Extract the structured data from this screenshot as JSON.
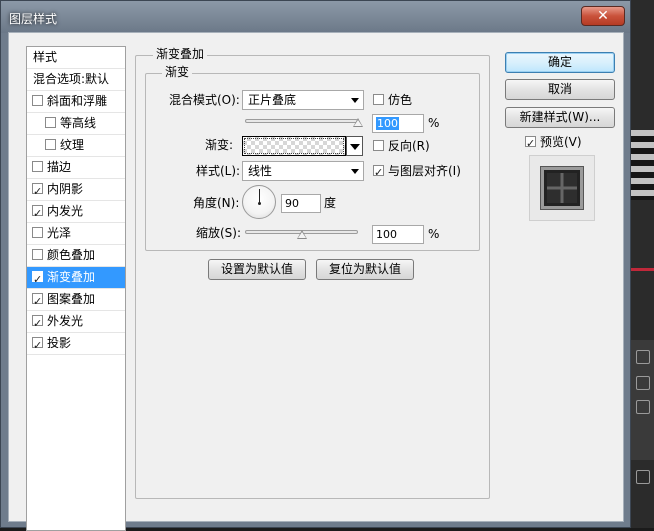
{
  "window": {
    "title": "图层样式",
    "close_glyph": "✕"
  },
  "style_list": {
    "header": "样式",
    "blend_options": "混合选项:默认",
    "items": [
      {
        "label": "斜面和浮雕",
        "checked": false,
        "indent": false
      },
      {
        "label": "等高线",
        "checked": false,
        "indent": true
      },
      {
        "label": "纹理",
        "checked": false,
        "indent": true
      },
      {
        "label": "描边",
        "checked": false,
        "indent": false
      },
      {
        "label": "内阴影",
        "checked": true,
        "indent": false
      },
      {
        "label": "内发光",
        "checked": true,
        "indent": false
      },
      {
        "label": "光泽",
        "checked": false,
        "indent": false
      },
      {
        "label": "颜色叠加",
        "checked": false,
        "indent": false
      },
      {
        "label": "渐变叠加",
        "checked": true,
        "indent": false,
        "selected": true
      },
      {
        "label": "图案叠加",
        "checked": true,
        "indent": false
      },
      {
        "label": "外发光",
        "checked": true,
        "indent": false
      },
      {
        "label": "投影",
        "checked": true,
        "indent": false
      }
    ]
  },
  "panel": {
    "outer_title": "渐变叠加",
    "inner_title": "渐变",
    "blend_mode_label": "混合模式(O):",
    "blend_mode_value": "正片叠底",
    "dither_label": "仿色",
    "opacity_value": "100",
    "opacity_unit": "%",
    "opacity_level": 1.0,
    "gradient_label": "渐变:",
    "reverse_label": "反向(R)",
    "style_label": "样式(L):",
    "style_value": "线性",
    "align_label": "与图层对齐(I)",
    "angle_label": "角度(N):",
    "angle_value": "90",
    "angle_unit": "度",
    "scale_label": "缩放(S):",
    "scale_value": "100",
    "scale_unit": "%",
    "scale_level": 0.5,
    "make_default": "设置为默认值",
    "reset_default": "复位为默认值"
  },
  "checkboxes": {
    "dither": false,
    "reverse": false,
    "align": true,
    "preview": true
  },
  "actions": {
    "ok": "确定",
    "cancel": "取消",
    "new_style": "新建样式(W)...",
    "preview_label": "预览(V)"
  },
  "colors": {
    "selected_row": "#3399ff",
    "titlebar": "#7c8998",
    "close": "#c9523b"
  }
}
